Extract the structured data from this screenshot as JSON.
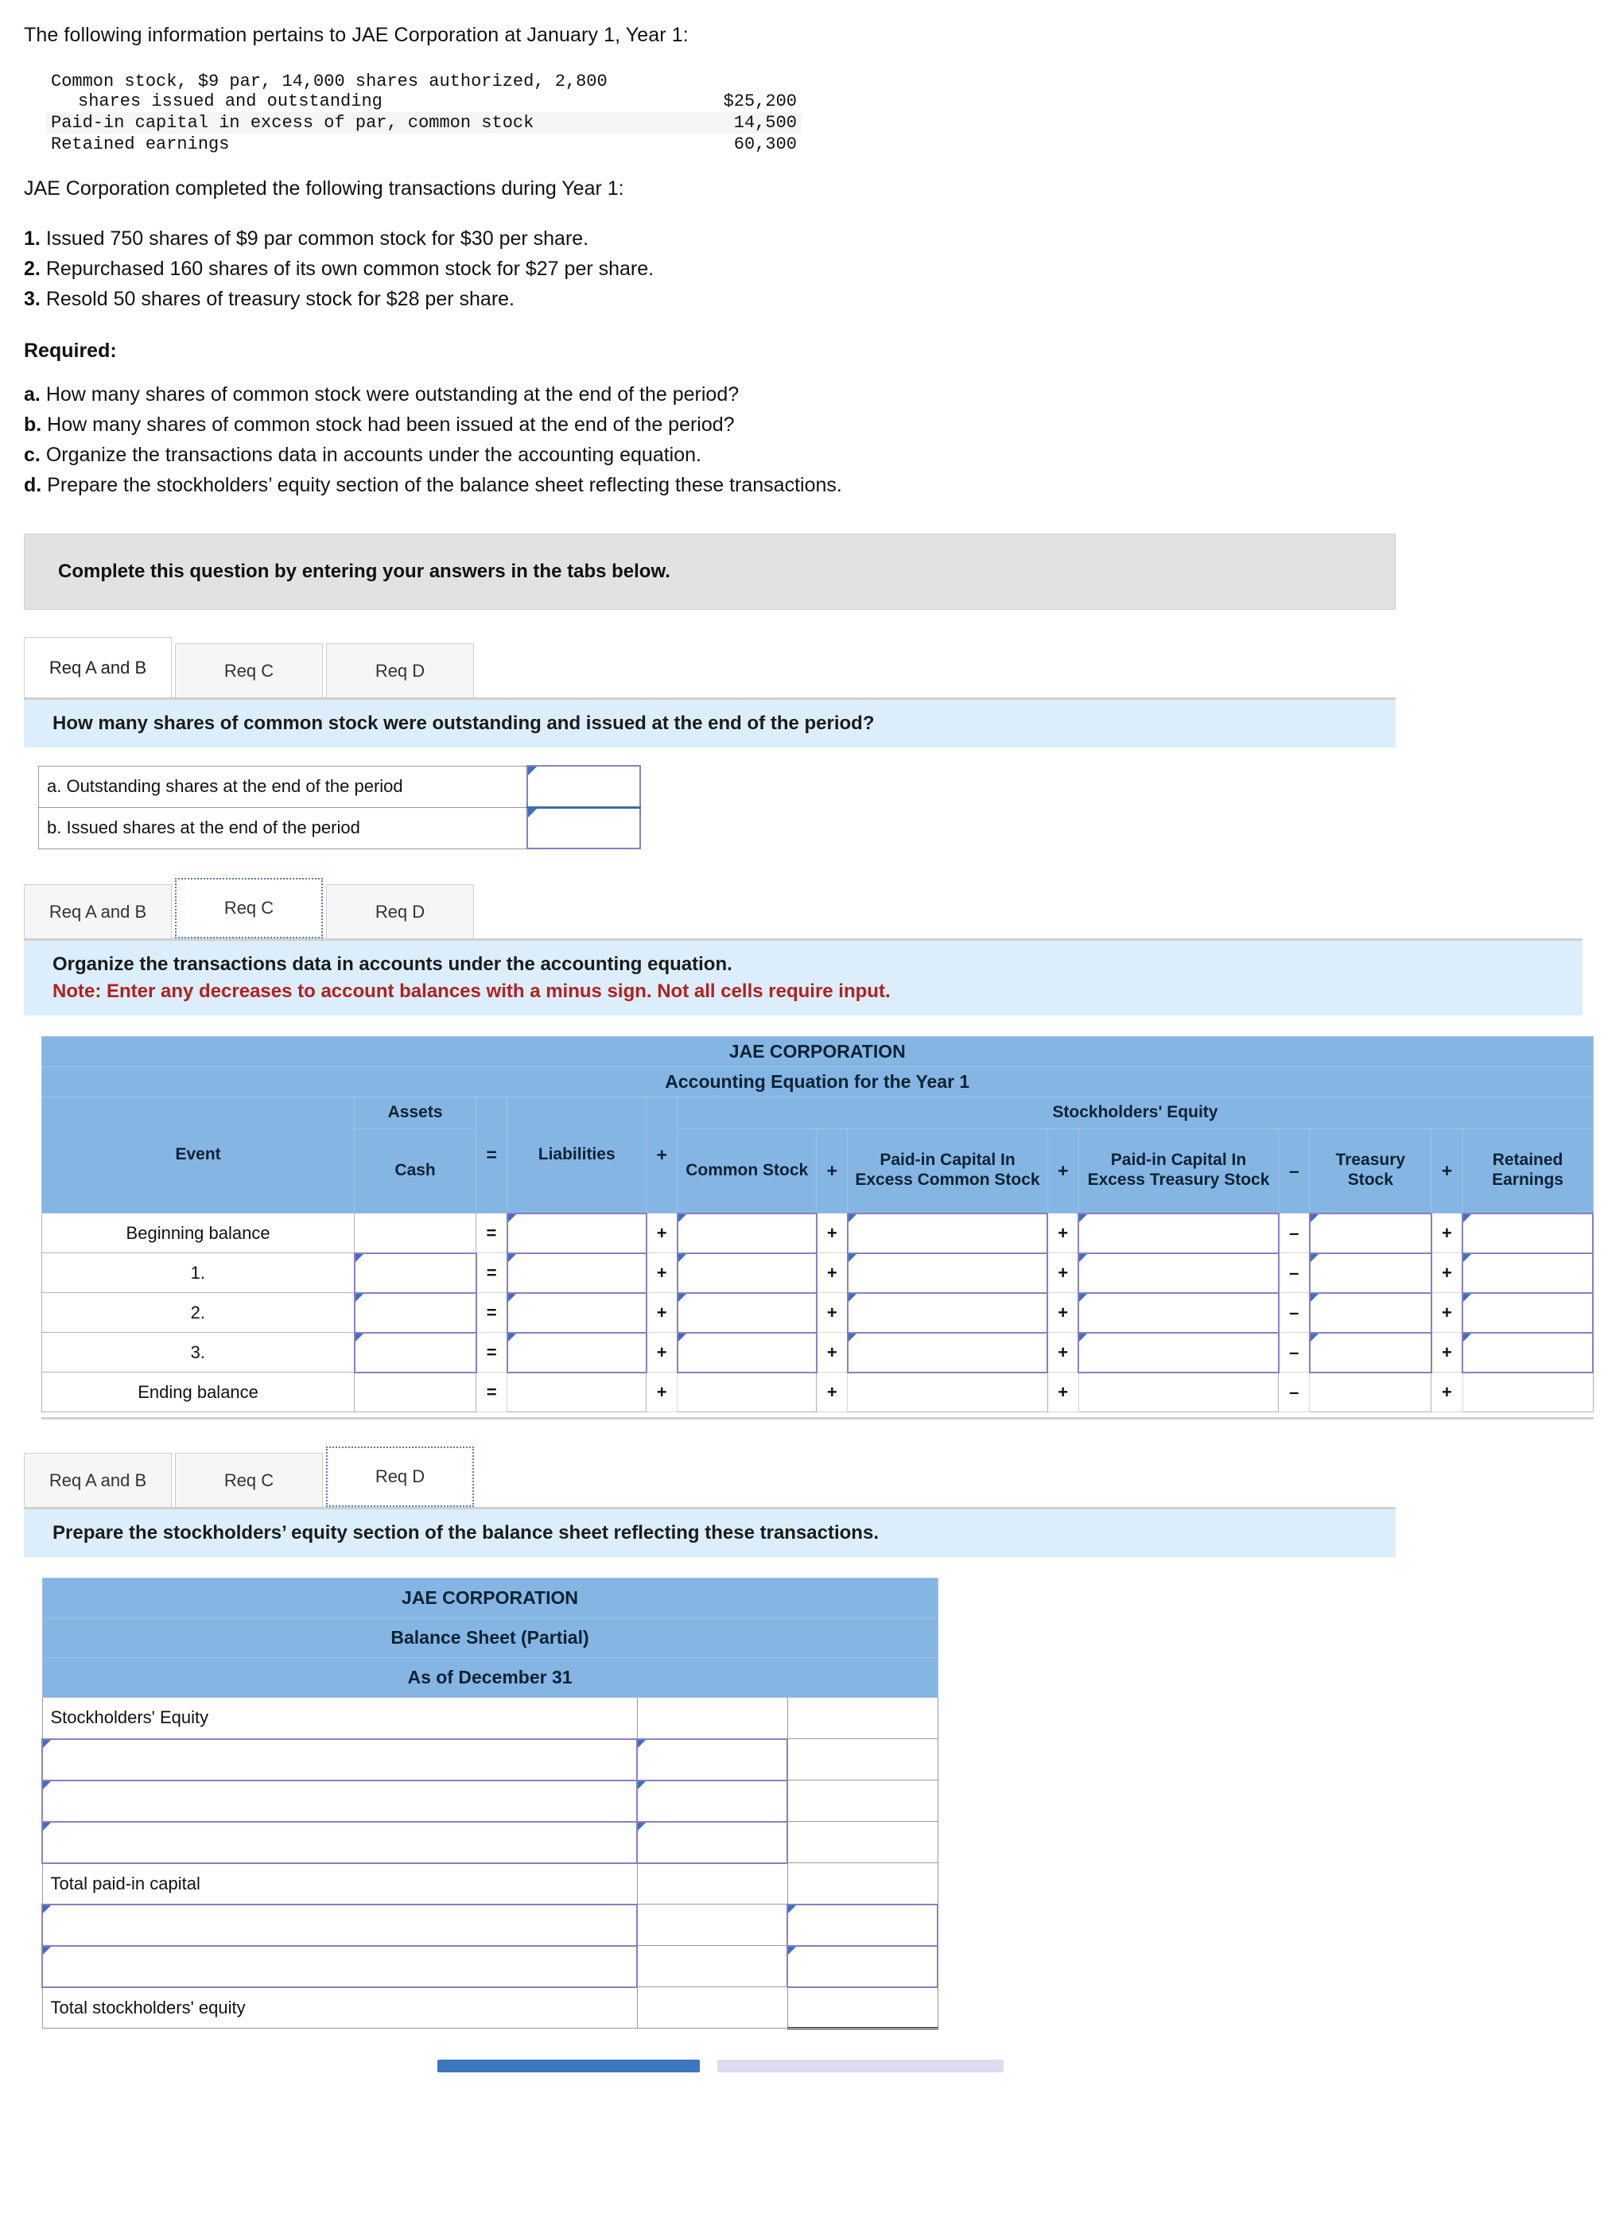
{
  "intro": {
    "line1": "The following information pertains to JAE Corporation at January 1, Year 1:",
    "line2": "JAE Corporation completed the following transactions during Year 1:"
  },
  "facts": {
    "rows": [
      {
        "label_1": "Common stock, $9 par, 14,000 shares authorized, 2,800",
        "label_2": "shares issued and outstanding",
        "amount": "$25,200",
        "shaded": false
      },
      {
        "label_1": "Paid-in capital in excess of par, common stock",
        "label_2": "",
        "amount": "14,500",
        "shaded": true
      },
      {
        "label_1": "Retained earnings",
        "label_2": "",
        "amount": "60,300",
        "shaded": false
      }
    ]
  },
  "transactions": [
    {
      "num": "1.",
      "text": "Issued 750 shares of $9 par common stock for $30 per share."
    },
    {
      "num": "2.",
      "text": "Repurchased 160 shares of its own common stock for $27 per share."
    },
    {
      "num": "3.",
      "text": "Resold 50 shares of treasury stock for $28 per share."
    }
  ],
  "required": {
    "heading": "Required:",
    "items": [
      {
        "letter": "a.",
        "text": "How many shares of common stock were outstanding at the end of the period?"
      },
      {
        "letter": "b.",
        "text": "How many shares of common stock had been issued at the end of the period?"
      },
      {
        "letter": "c.",
        "text": "Organize the transactions data in accounts under the accounting equation."
      },
      {
        "letter": "d.",
        "text": "Prepare the stockholders’ equity section of the balance sheet reflecting these transactions."
      }
    ]
  },
  "instruction_banner": "Complete this question by entering your answers in the tabs below.",
  "tabs": {
    "labels": [
      "Req A and B",
      "Req C",
      "Req D"
    ]
  },
  "req_ab": {
    "question": "How many shares of common stock were outstanding and issued at the end of the period?",
    "rows": [
      {
        "label": "a. Outstanding shares at the end of the period",
        "value": "",
        "placeholder": ""
      },
      {
        "label": "b. Issued shares at the end of the period",
        "value": "",
        "placeholder": ""
      }
    ]
  },
  "req_c": {
    "question": "Organize the transactions data in accounts under the accounting equation.",
    "note": "Note: Enter any decreases to account balances with a minus sign. Not all cells require input.",
    "table": {
      "company": "JAE CORPORATION",
      "subtitle": "Accounting Equation for the Year 1",
      "group_assets": "Assets",
      "group_equity": "Stockholders' Equity",
      "col_event": "Event",
      "col_cash": "Cash",
      "col_liabilities": "Liabilities",
      "col_common_stock": "Common Stock",
      "col_picec": "Paid-in Capital In Excess Common Stock",
      "col_picets": "Paid-in Capital In Excess Treasury Stock",
      "col_treasury": "Treasury Stock",
      "col_retained": "Retained Earnings",
      "ops": {
        "eq": "=",
        "plus": "+",
        "minus": "–"
      },
      "rows": [
        {
          "event": "Beginning balance",
          "cash": "",
          "liabilities": "",
          "common_stock": "",
          "picec": "",
          "picets": "",
          "treasury": "",
          "retained": ""
        },
        {
          "event": "1.",
          "cash": "",
          "liabilities": "",
          "common_stock": "",
          "picec": "",
          "picets": "",
          "treasury": "",
          "retained": ""
        },
        {
          "event": "2.",
          "cash": "",
          "liabilities": "",
          "common_stock": "",
          "picec": "",
          "picets": "",
          "treasury": "",
          "retained": ""
        },
        {
          "event": "3.",
          "cash": "",
          "liabilities": "",
          "common_stock": "",
          "picec": "",
          "picets": "",
          "treasury": "",
          "retained": ""
        },
        {
          "event": "Ending balance",
          "cash": "",
          "liabilities": "",
          "common_stock": "",
          "picec": "",
          "picets": "",
          "treasury": "",
          "retained": ""
        }
      ]
    }
  },
  "req_d": {
    "question": "Prepare the stockholders’ equity section of the balance sheet reflecting these transactions.",
    "table": {
      "company": "JAE CORPORATION",
      "statement": "Balance Sheet (Partial)",
      "date": "As of December 31",
      "section_header": "Stockholders' Equity",
      "total_paid_in": "Total paid-in capital",
      "total_equity": "Total stockholders' equity",
      "rows": [
        {
          "label": "",
          "amount": "",
          "total": ""
        },
        {
          "label": "",
          "amount": "",
          "total": ""
        },
        {
          "label": "",
          "amount": "",
          "total": ""
        },
        {
          "label": "",
          "amount": "",
          "total": ""
        }
      ],
      "after_total_rows": [
        {
          "label": "",
          "amount": "",
          "total": ""
        },
        {
          "label": "",
          "amount": "",
          "total": ""
        }
      ]
    }
  },
  "colors": {
    "header_blue": "#85b6e3",
    "banner_blue": "#dceefb",
    "note_red": "#b32020",
    "input_border": "#8a7fc4",
    "prev_button": "#3b76c0",
    "next_button": "#dcdcf0"
  }
}
